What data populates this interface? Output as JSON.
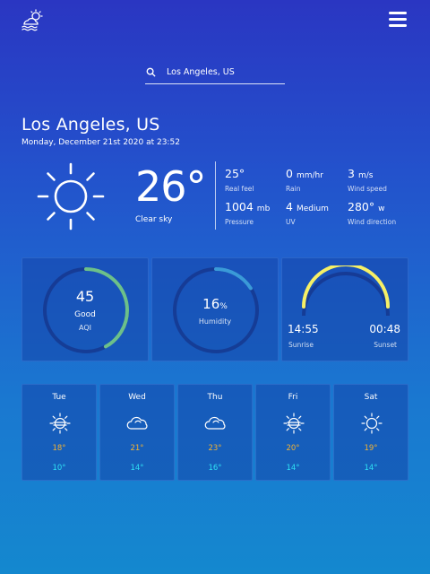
{
  "header": {
    "logo_icon": "cloud-sun-waves-icon",
    "menu_icon": "hamburger-menu-icon"
  },
  "search": {
    "value": "Los Angeles, US",
    "placeholder": "Los Angeles, US",
    "icon": "search-icon"
  },
  "location": {
    "city": "Los Angeles, US",
    "datetime": "Monday, December 21st 2020 at 23:52"
  },
  "current": {
    "icon": "sun-icon",
    "temperature": "26°",
    "condition": "Clear sky",
    "metrics": [
      {
        "value": "25°",
        "unit": "",
        "label": "Real feel"
      },
      {
        "value": "0",
        "unit": "mm/hr",
        "label": "Rain"
      },
      {
        "value": "3",
        "unit": "m/s",
        "label": "Wind speed"
      },
      {
        "value": "1004",
        "unit": "mb",
        "label": "Pressure"
      },
      {
        "value": "4",
        "unit": "Medium",
        "label": "UV"
      },
      {
        "value": "280°",
        "unit": "w",
        "label": "Wind direction"
      }
    ]
  },
  "air_quality": {
    "value": "45",
    "level": "Good",
    "label": "AQI",
    "fraction": 0.42,
    "color": "#6cc08a"
  },
  "humidity": {
    "value": "16",
    "unit": "%",
    "label": "Humidity",
    "fraction": 0.16,
    "color": "#3a9ad8"
  },
  "sun": {
    "sunrise": "14:55",
    "sunrise_label": "Sunrise",
    "sunset": "00:48",
    "sunset_label": "Sunset",
    "arc_color": "#f6f066"
  },
  "forecast": [
    {
      "day": "Tue",
      "icon": "sun-haze-icon",
      "high": "18°",
      "low": "10°"
    },
    {
      "day": "Wed",
      "icon": "cloud-icon",
      "high": "21°",
      "low": "14°"
    },
    {
      "day": "Thu",
      "icon": "cloud-icon",
      "high": "23°",
      "low": "16°"
    },
    {
      "day": "Fri",
      "icon": "sun-haze-icon",
      "high": "20°",
      "low": "14°"
    },
    {
      "day": "Sat",
      "icon": "sun-icon",
      "high": "19°",
      "low": "14°"
    }
  ],
  "colors": {
    "high_temp": "#f2b234",
    "low_temp": "#2fe0f4"
  }
}
